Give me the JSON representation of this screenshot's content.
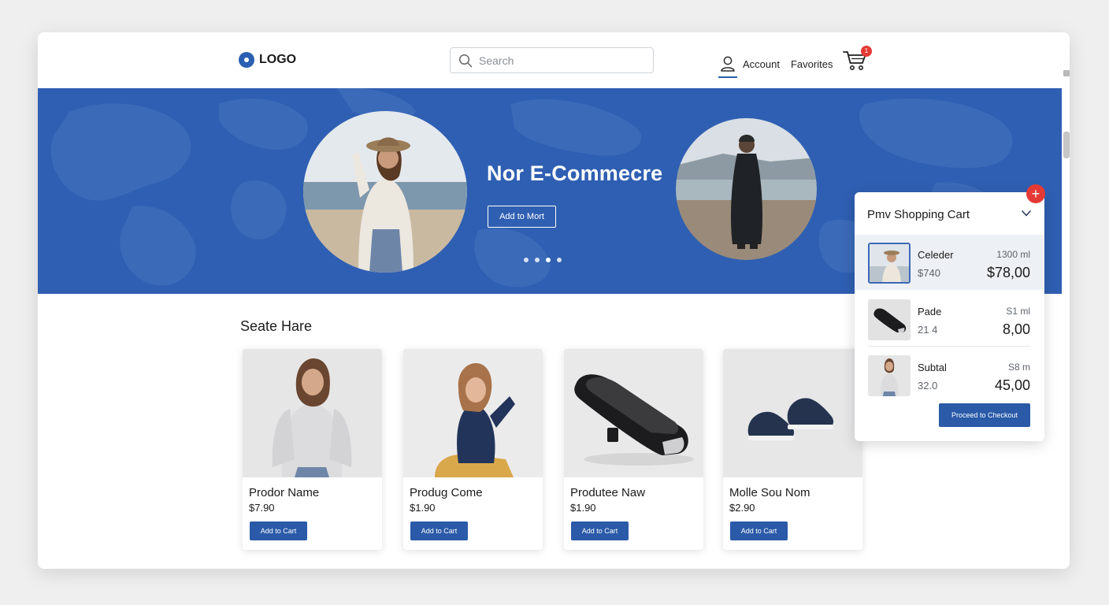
{
  "header": {
    "logo_text": "LOGO",
    "search_placeholder": "Search",
    "nav_account": "Account",
    "nav_favorites": "Favorites",
    "cart_count": "1"
  },
  "hero": {
    "title": "Nor E-Commecre",
    "button_label": "Add to Mort",
    "slides_count": 4,
    "active_slide": 3
  },
  "section": {
    "title": "Seate Hare"
  },
  "products": [
    {
      "name": "Prodor Name",
      "price": "$7.90",
      "button": "Add to Cart",
      "image": "woman-in-gray-top"
    },
    {
      "name": "Produg Come",
      "price": "$1.90",
      "button": "Add to Cart",
      "image": "girl-in-navy-cardigan"
    },
    {
      "name": "Produtee Naw",
      "price": "$1.90",
      "button": "Add to Cart",
      "image": "black-gadget"
    },
    {
      "name": "Molle Sou Nom",
      "price": "$2.90",
      "button": "Add to Cart",
      "image": "navy-sneakers"
    }
  ],
  "cart": {
    "title": "Pmv Shopping Cart",
    "items": [
      {
        "name": "Celeder",
        "sub": "$740",
        "qty": "1300 ml",
        "price": "$78,00"
      },
      {
        "name": "Pade",
        "sub": "21 4",
        "qty": "S1 ml",
        "price": "8,00"
      },
      {
        "name": "Subtal",
        "sub": "32.0",
        "qty": "S8 m",
        "price": "45,00"
      }
    ],
    "checkout_label": "Proceed to Checkout"
  },
  "colors": {
    "brand_blue": "#2f5fb2",
    "button_blue": "#2a5aa8",
    "badge_red": "#e53935"
  }
}
